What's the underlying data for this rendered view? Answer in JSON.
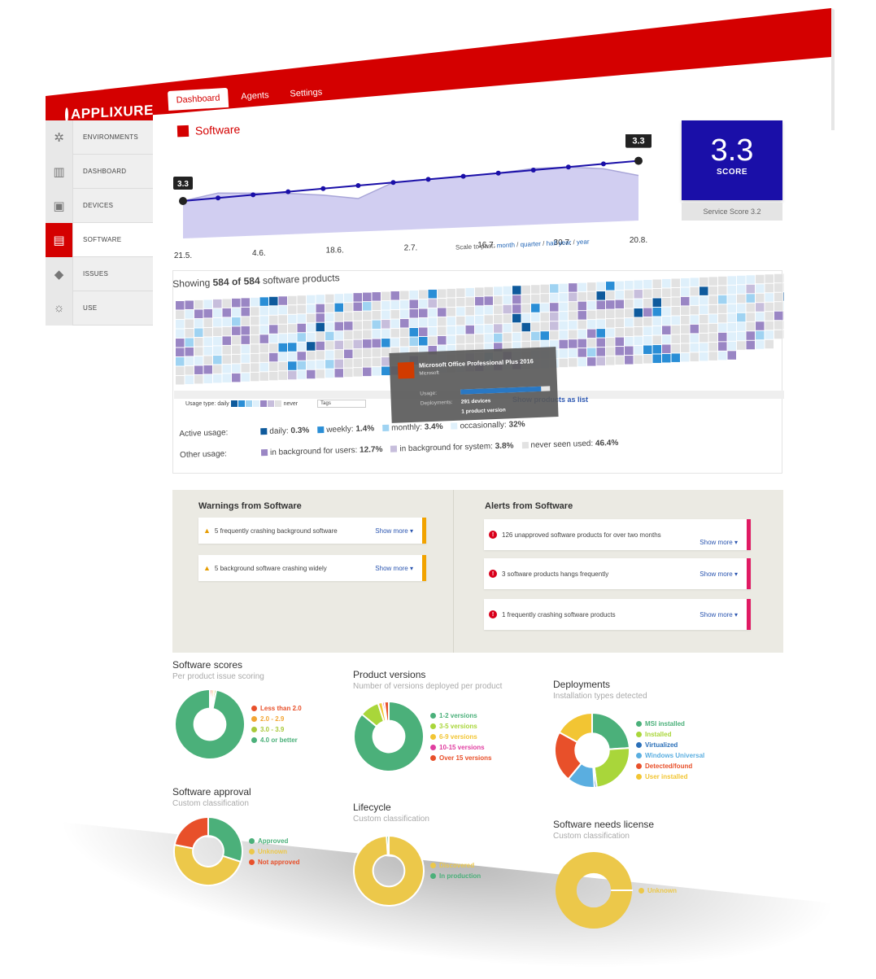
{
  "brand": {
    "logo_text": "APPLIXURE",
    "red": "#d40000",
    "blue": "#1a0fa8"
  },
  "tabs": [
    {
      "label": "Dashboard",
      "active": true
    },
    {
      "label": "Agents"
    },
    {
      "label": "Settings"
    }
  ],
  "sidebar": {
    "items": [
      {
        "label": "ENVIRONMENTS",
        "icon": "network-icon"
      },
      {
        "label": "DASHBOARD",
        "icon": "chart-icon"
      },
      {
        "label": "DEVICES",
        "icon": "device-icon"
      },
      {
        "label": "SOFTWARE",
        "icon": "software-icon",
        "active": true
      },
      {
        "label": "ISSUES",
        "icon": "warning-icon"
      },
      {
        "label": "USE",
        "icon": "lightbulb-icon"
      }
    ]
  },
  "section": {
    "title": "Software"
  },
  "trend": {
    "first_label": "3.3",
    "last_label": "3.3",
    "x_labels": [
      "21.5.",
      "4.6.",
      "18.6.",
      "2.7.",
      "16.7.",
      "30.7.",
      "20.8."
    ],
    "values": [
      3.0,
      3.05,
      3.1,
      3.15,
      3.2,
      3.25,
      3.3,
      3.35,
      3.4,
      3.45,
      3.5,
      3.55,
      3.6,
      3.65
    ],
    "secondary": [
      3.0,
      3.2,
      3.15,
      3.1,
      3.0,
      2.85,
      3.3,
      3.35,
      3.4,
      3.45,
      3.55,
      3.55,
      3.45,
      3.2
    ]
  },
  "scale": {
    "prefix": "Scale to past:",
    "options": [
      "month",
      "quarter",
      "half year",
      "year"
    ]
  },
  "score": {
    "value": "3.3",
    "label": "SCORE",
    "service": "Service Score 3.2"
  },
  "heatmap": {
    "showing_prefix": "Showing ",
    "showing_count": "584 of 584",
    "showing_suffix": " software products",
    "legend_label": "Usage type:",
    "legend_daily": "daily",
    "legend_never": "never",
    "tags_placeholder": "Tags",
    "list_link": "Show products as list",
    "colors": [
      "#0e5a9c",
      "#2a8ed6",
      "#9fd3f2",
      "#dff0fb",
      "#9a86c4",
      "#c7bedc",
      "#e2e2e2"
    ]
  },
  "tooltip": {
    "title": "Microsoft Office Professional Plus 2016",
    "vendor": "Microsoft",
    "usage_label": "Usage:",
    "usage_fill": 0.9,
    "deployments_label": "Deployments:",
    "deployments_value": "291 devices",
    "versions": "1 product version"
  },
  "usage": {
    "active_label": "Active usage:",
    "other_label": "Other usage:",
    "active": [
      {
        "name": "daily:",
        "value": "0.3",
        "color": "#0e5a9c"
      },
      {
        "name": "weekly:",
        "value": "1.4",
        "color": "#2a8ed6"
      },
      {
        "name": "monthly:",
        "value": "3.4",
        "color": "#9fd3f2"
      },
      {
        "name": "occasionally:",
        "value": "32",
        "color": "#dff0fb"
      }
    ],
    "other": [
      {
        "name": "in background for users:",
        "value": "12.7",
        "color": "#9a86c4"
      },
      {
        "name": "in background for system:",
        "value": "3.8",
        "color": "#c7bedc"
      },
      {
        "name": "never seen used:",
        "value": "46.4",
        "color": "#e2e2e2"
      }
    ],
    "percent": "%"
  },
  "warnings": {
    "title": "Warnings from Software",
    "items": [
      {
        "text": "5 frequently crashing background software",
        "more": "Show more ▾"
      },
      {
        "text": "5 background software crashing widely",
        "more": "Show more ▾"
      }
    ]
  },
  "alerts": {
    "title": "Alerts from Software",
    "items": [
      {
        "text": "126 unapproved software products for over two months",
        "more": "Show more ▾"
      },
      {
        "text": "3 software products hangs frequently",
        "more": "Show more ▾"
      },
      {
        "text": "1 frequently crashing software products",
        "more": "Show more ▾"
      }
    ]
  },
  "donuts": [
    {
      "title": "Software scores",
      "subtitle": "Per product issue scoring",
      "slices": [
        {
          "label": "Less than 2.0",
          "value": 1,
          "color": "#e8502a"
        },
        {
          "label": "2.0 - 2.9",
          "value": 1,
          "color": "#f2a533"
        },
        {
          "label": "3.0 - 3.9",
          "value": 1,
          "color": "#a9c93a"
        },
        {
          "label": "4.0 or better",
          "value": 97,
          "color": "#4bb07a"
        }
      ]
    },
    {
      "title": "Product versions",
      "subtitle": "Number of versions deployed per product",
      "slices": [
        {
          "label": "1-2 versions",
          "value": 86,
          "color": "#4bb07a"
        },
        {
          "label": "3-5 versions",
          "value": 9,
          "color": "#a9d63a"
        },
        {
          "label": "6-9 versions",
          "value": 2,
          "color": "#f2c533"
        },
        {
          "label": "10-15 versions",
          "value": 1,
          "color": "#e03ea0"
        },
        {
          "label": "Over 15 versions",
          "value": 2,
          "color": "#e8502a"
        }
      ]
    },
    {
      "title": "Deployments",
      "subtitle": "Installation types detected",
      "slices": [
        {
          "label": "MSI installed",
          "value": 24,
          "color": "#4bb07a"
        },
        {
          "label": "Installed",
          "value": 24,
          "color": "#a9d63a"
        },
        {
          "label": "Virtualized",
          "value": 1,
          "color": "#2a6fb8"
        },
        {
          "label": "Windows Universal",
          "value": 12,
          "color": "#5aaee0"
        },
        {
          "label": "Detected/found",
          "value": 22,
          "color": "#e8502a"
        },
        {
          "label": "User installed",
          "value": 17,
          "color": "#f2c533"
        }
      ]
    },
    {
      "title": "Software approval",
      "subtitle": "Custom classification",
      "slices": [
        {
          "label": "Approved",
          "value": 30,
          "color": "#4bb07a"
        },
        {
          "label": "Unknown",
          "value": 48,
          "color": "#ecc84a"
        },
        {
          "label": "Not approved",
          "value": 22,
          "color": "#e8502a"
        }
      ]
    },
    {
      "title": "Lifecycle",
      "subtitle": "Custom classification",
      "slices": [
        {
          "label": "Discovered",
          "value": 99,
          "color": "#ecc84a"
        },
        {
          "label": "In production",
          "value": 1,
          "color": "#4bb07a"
        }
      ]
    },
    {
      "title": "Software needs license",
      "subtitle": "Custom classification",
      "slices": [
        {
          "label": "Unknown",
          "value": 100,
          "color": "#ecc84a"
        }
      ]
    }
  ]
}
